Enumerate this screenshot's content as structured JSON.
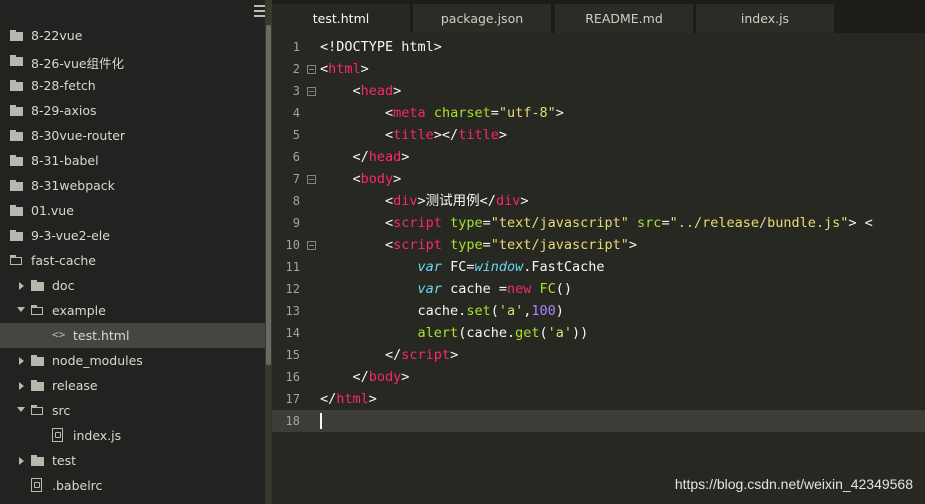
{
  "sidebar": {
    "items": [
      {
        "label": "8-22vue",
        "type": "folder"
      },
      {
        "label": "8-26-vue组件化",
        "type": "folder"
      },
      {
        "label": "8-28-fetch",
        "type": "folder"
      },
      {
        "label": "8-29-axios",
        "type": "folder"
      },
      {
        "label": "8-30vue-router",
        "type": "folder"
      },
      {
        "label": "8-31-babel",
        "type": "folder"
      },
      {
        "label": "8-31webpack",
        "type": "folder"
      },
      {
        "label": "01.vue",
        "type": "folder"
      },
      {
        "label": "9-3-vue2-ele",
        "type": "folder"
      },
      {
        "label": "fast-cache",
        "type": "folder-open"
      },
      {
        "label": "doc",
        "type": "folder"
      },
      {
        "label": "example",
        "type": "folder-open"
      },
      {
        "label": "test.html",
        "type": "code-file"
      },
      {
        "label": "node_modules",
        "type": "folder"
      },
      {
        "label": "release",
        "type": "folder"
      },
      {
        "label": "src",
        "type": "folder-open"
      },
      {
        "label": "index.js",
        "type": "file"
      },
      {
        "label": "test",
        "type": "folder"
      },
      {
        "label": ".babelrc",
        "type": "file"
      }
    ],
    "code_file_glyph": "<>"
  },
  "tabs": [
    {
      "label": "test.html",
      "active": true
    },
    {
      "label": "package.json",
      "active": false
    },
    {
      "label": "README.md",
      "active": false
    },
    {
      "label": "index.js",
      "active": false
    }
  ],
  "editor": {
    "line_numbers": [
      "1",
      "2",
      "3",
      "4",
      "5",
      "6",
      "7",
      "8",
      "9",
      "10",
      "11",
      "12",
      "13",
      "14",
      "15",
      "16",
      "17",
      "18"
    ],
    "lines": [
      [
        {
          "t": "<!DOCTYPE html>",
          "c": "pl"
        }
      ],
      [
        {
          "t": "<",
          "c": "pl"
        },
        {
          "t": "html",
          "c": "tg"
        },
        {
          "t": ">",
          "c": "pl"
        }
      ],
      [
        {
          "t": "    <",
          "c": "pl"
        },
        {
          "t": "head",
          "c": "tg"
        },
        {
          "t": ">",
          "c": "pl"
        }
      ],
      [
        {
          "t": "        <",
          "c": "pl"
        },
        {
          "t": "meta",
          "c": "tg"
        },
        {
          "t": " ",
          "c": "pl"
        },
        {
          "t": "charset",
          "c": "at"
        },
        {
          "t": "=",
          "c": "pl"
        },
        {
          "t": "\"utf-8\"",
          "c": "st"
        },
        {
          "t": ">",
          "c": "pl"
        }
      ],
      [
        {
          "t": "        <",
          "c": "pl"
        },
        {
          "t": "title",
          "c": "tg"
        },
        {
          "t": "></",
          "c": "pl"
        },
        {
          "t": "title",
          "c": "tg"
        },
        {
          "t": ">",
          "c": "pl"
        }
      ],
      [
        {
          "t": "    </",
          "c": "pl"
        },
        {
          "t": "head",
          "c": "tg"
        },
        {
          "t": ">",
          "c": "pl"
        }
      ],
      [
        {
          "t": "    <",
          "c": "pl"
        },
        {
          "t": "body",
          "c": "tg"
        },
        {
          "t": ">",
          "c": "pl"
        }
      ],
      [
        {
          "t": "        <",
          "c": "pl"
        },
        {
          "t": "div",
          "c": "tg"
        },
        {
          "t": ">测试用例</",
          "c": "pl"
        },
        {
          "t": "div",
          "c": "tg"
        },
        {
          "t": ">",
          "c": "pl"
        }
      ],
      [
        {
          "t": "        <",
          "c": "pl"
        },
        {
          "t": "script",
          "c": "tg"
        },
        {
          "t": " ",
          "c": "pl"
        },
        {
          "t": "type",
          "c": "at"
        },
        {
          "t": "=",
          "c": "pl"
        },
        {
          "t": "\"text/javascript\"",
          "c": "st"
        },
        {
          "t": " ",
          "c": "pl"
        },
        {
          "t": "src",
          "c": "at"
        },
        {
          "t": "=",
          "c": "pl"
        },
        {
          "t": "\"../release/bundle.js\"",
          "c": "st"
        },
        {
          "t": "> <",
          "c": "pl"
        }
      ],
      [
        {
          "t": "        <",
          "c": "pl"
        },
        {
          "t": "script",
          "c": "tg"
        },
        {
          "t": " ",
          "c": "pl"
        },
        {
          "t": "type",
          "c": "at"
        },
        {
          "t": "=",
          "c": "pl"
        },
        {
          "t": "\"text/javascript\"",
          "c": "st"
        },
        {
          "t": ">",
          "c": "pl"
        }
      ],
      [
        {
          "t": "            ",
          "c": "pl"
        },
        {
          "t": "var",
          "c": "kw"
        },
        {
          "t": " FC=",
          "c": "pl"
        },
        {
          "t": "window",
          "c": "kw"
        },
        {
          "t": ".FastCache",
          "c": "pl"
        }
      ],
      [
        {
          "t": "            ",
          "c": "pl"
        },
        {
          "t": "var",
          "c": "kw"
        },
        {
          "t": " cache =",
          "c": "pl"
        },
        {
          "t": "new",
          "c": "nw"
        },
        {
          "t": " ",
          "c": "pl"
        },
        {
          "t": "FC",
          "c": "fn"
        },
        {
          "t": "()",
          "c": "pl"
        }
      ],
      [
        {
          "t": "            cache.",
          "c": "pl"
        },
        {
          "t": "set",
          "c": "fn"
        },
        {
          "t": "(",
          "c": "pl"
        },
        {
          "t": "'a'",
          "c": "st"
        },
        {
          "t": ",",
          "c": "pl"
        },
        {
          "t": "100",
          "c": "nm"
        },
        {
          "t": ")",
          "c": "pl"
        }
      ],
      [
        {
          "t": "            ",
          "c": "pl"
        },
        {
          "t": "alert",
          "c": "fn"
        },
        {
          "t": "(cache.",
          "c": "pl"
        },
        {
          "t": "get",
          "c": "fn"
        },
        {
          "t": "(",
          "c": "pl"
        },
        {
          "t": "'a'",
          "c": "st"
        },
        {
          "t": "))",
          "c": "pl"
        }
      ],
      [
        {
          "t": "        </",
          "c": "pl"
        },
        {
          "t": "script",
          "c": "tg"
        },
        {
          "t": ">",
          "c": "pl"
        }
      ],
      [
        {
          "t": "    </",
          "c": "pl"
        },
        {
          "t": "body",
          "c": "tg"
        },
        {
          "t": ">",
          "c": "pl"
        }
      ],
      [
        {
          "t": "</",
          "c": "pl"
        },
        {
          "t": "html",
          "c": "tg"
        },
        {
          "t": ">",
          "c": "pl"
        }
      ],
      []
    ]
  },
  "watermark": "https://blog.csdn.net/weixin_42349568",
  "colors": {
    "background": "#272822",
    "tag": "#f92672",
    "attribute": "#a6e22e",
    "string": "#e6db74",
    "keyword": "#66d9ef",
    "number": "#ae81ff"
  }
}
